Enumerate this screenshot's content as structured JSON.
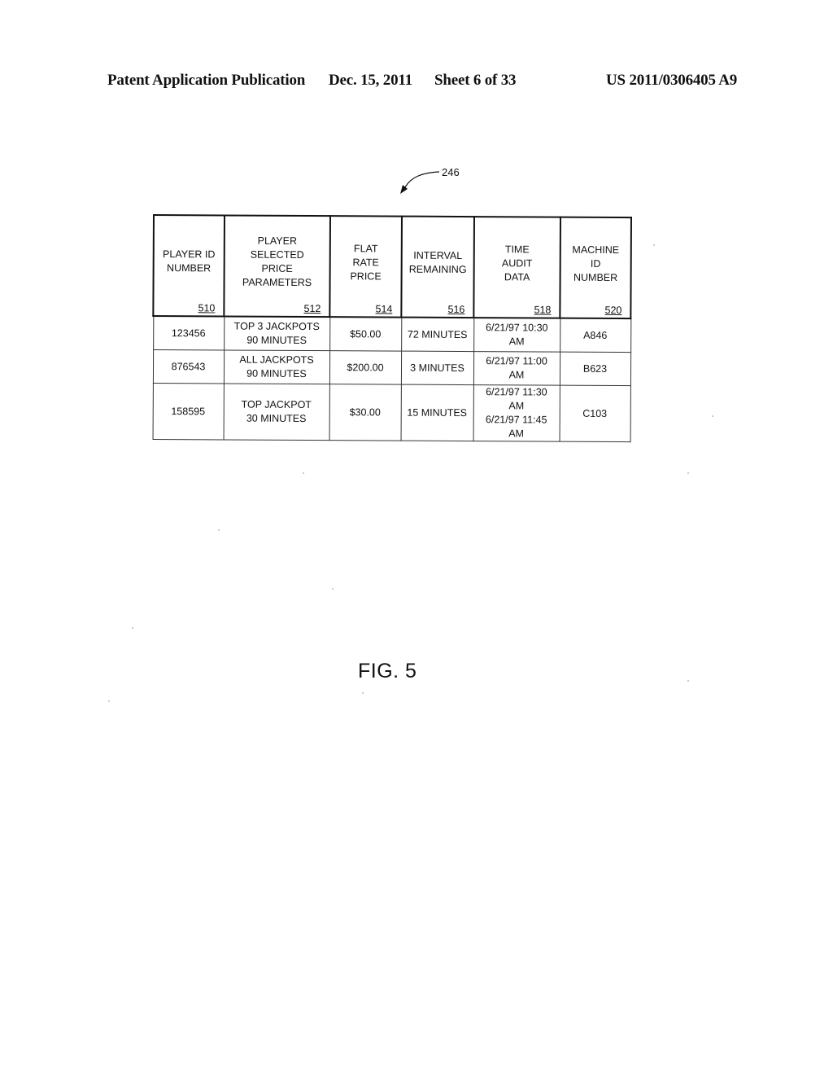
{
  "header": {
    "publication": "Patent Application Publication",
    "date": "Dec. 15, 2011",
    "sheet": "Sheet 6 of 33",
    "patent_number": "US 2011/0306405 A9"
  },
  "figure": {
    "reference_numeral": "246",
    "caption": "FIG. 5"
  },
  "table": {
    "columns": [
      {
        "title": "PLAYER ID\nNUMBER",
        "ref": "510"
      },
      {
        "title": "PLAYER\nSELECTED\nPRICE\nPARAMETERS",
        "ref": "512"
      },
      {
        "title": "FLAT\nRATE\nPRICE",
        "ref": "514"
      },
      {
        "title": "INTERVAL\nREMAINING",
        "ref": "516"
      },
      {
        "title": "TIME\nAUDIT\nDATA",
        "ref": "518"
      },
      {
        "title": "MACHINE\nID\nNUMBER",
        "ref": "520"
      }
    ],
    "rows": [
      [
        "123456",
        "TOP 3 JACKPOTS\n90 MINUTES",
        "$50.00",
        "72 MINUTES",
        "6/21/97 10:30 AM",
        "A846"
      ],
      [
        "876543",
        "ALL JACKPOTS\n90 MINUTES",
        "$200.00",
        "3 MINUTES",
        "6/21/97 11:00 AM",
        "B623"
      ],
      [
        "158595",
        "TOP JACKPOT\n30 MINUTES",
        "$30.00",
        "15 MINUTES",
        "6/21/97 11:30 AM\n6/21/97 11:45 AM",
        "C103"
      ]
    ]
  }
}
